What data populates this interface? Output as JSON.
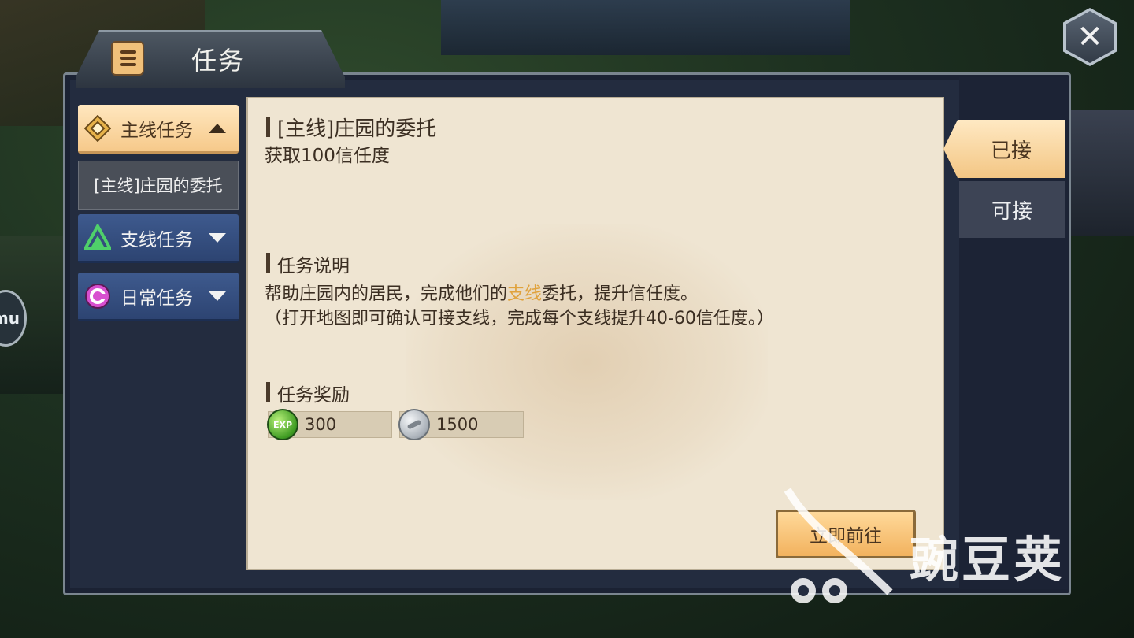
{
  "window": {
    "title": "任务"
  },
  "sidebar": {
    "categories": [
      {
        "label": "主线任务",
        "expanded": true,
        "icon": "diamond-quest-icon"
      },
      {
        "label": "支线任务",
        "expanded": false,
        "icon": "triangle-quest-icon"
      },
      {
        "label": "日常任务",
        "expanded": false,
        "icon": "circle-quest-icon"
      }
    ],
    "sub_item": "[主线]庄园的委托"
  },
  "quest": {
    "title": "[主线]庄园的委托",
    "objective": "获取100信任度",
    "desc_heading": "任务说明",
    "desc_line1_pre": "帮助庄园内的居民，完成他们的",
    "desc_line1_hl": "支线",
    "desc_line1_post": "委托，提升信任度。",
    "desc_line2": "（打开地图即可确认可接支线，完成每个支线提升40-60信任度。）",
    "reward_heading": "任务奖励",
    "rewards": [
      {
        "icon": "exp-icon",
        "icon_text": "EXP",
        "value": "300"
      },
      {
        "icon": "silver-coin-icon",
        "value": "1500"
      }
    ],
    "go_button": "立即前往"
  },
  "tabs": {
    "accepted": "已接",
    "available": "可接"
  },
  "watermark": "豌豆荚",
  "side_bubble": "mu",
  "colors": {
    "highlight": "#e0a23c",
    "panel": "#232c3f",
    "card": "#efe5d2"
  }
}
